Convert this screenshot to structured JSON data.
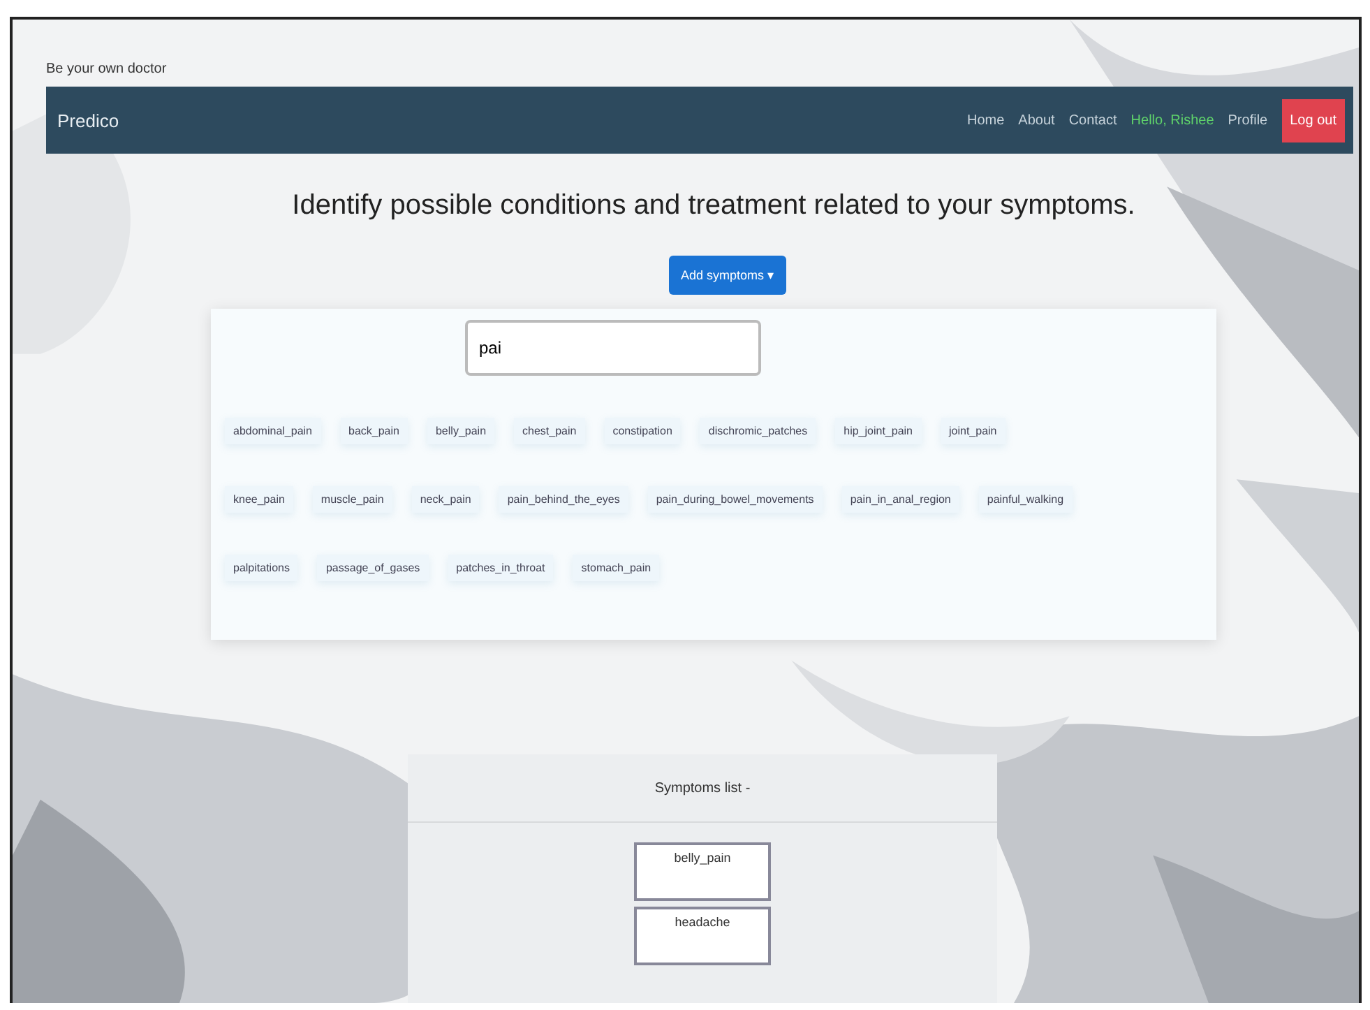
{
  "tagline": "Be your own doctor",
  "navbar": {
    "brand": "Predico",
    "links": [
      {
        "label": "Home",
        "kind": "link"
      },
      {
        "label": "About",
        "kind": "link"
      },
      {
        "label": "Contact",
        "kind": "link"
      },
      {
        "label": "Hello, Rishee",
        "kind": "greeting"
      },
      {
        "label": "Profile",
        "kind": "link"
      },
      {
        "label": "Log out",
        "kind": "button"
      }
    ]
  },
  "heading": "Identify possible conditions and treatment related to your symptoms.",
  "add_button": "Add symptoms ▾",
  "search": {
    "value": "pai"
  },
  "suggestion_rows": [
    [
      "abdominal_pain",
      "back_pain",
      "belly_pain",
      "chest_pain",
      "constipation",
      "dischromic_patches",
      "hip_joint_pain",
      "joint_pain"
    ],
    [
      "knee_pain",
      "muscle_pain",
      "neck_pain",
      "pain_behind_the_eyes",
      "pain_during_bowel_movements",
      "pain_in_anal_region",
      "painful_walking"
    ],
    [
      "palpitations",
      "passage_of_gases",
      "patches_in_throat",
      "stomach_pain"
    ]
  ],
  "symptoms_list": {
    "title": "Symptoms list -",
    "items": [
      "belly_pain",
      "headache"
    ]
  }
}
